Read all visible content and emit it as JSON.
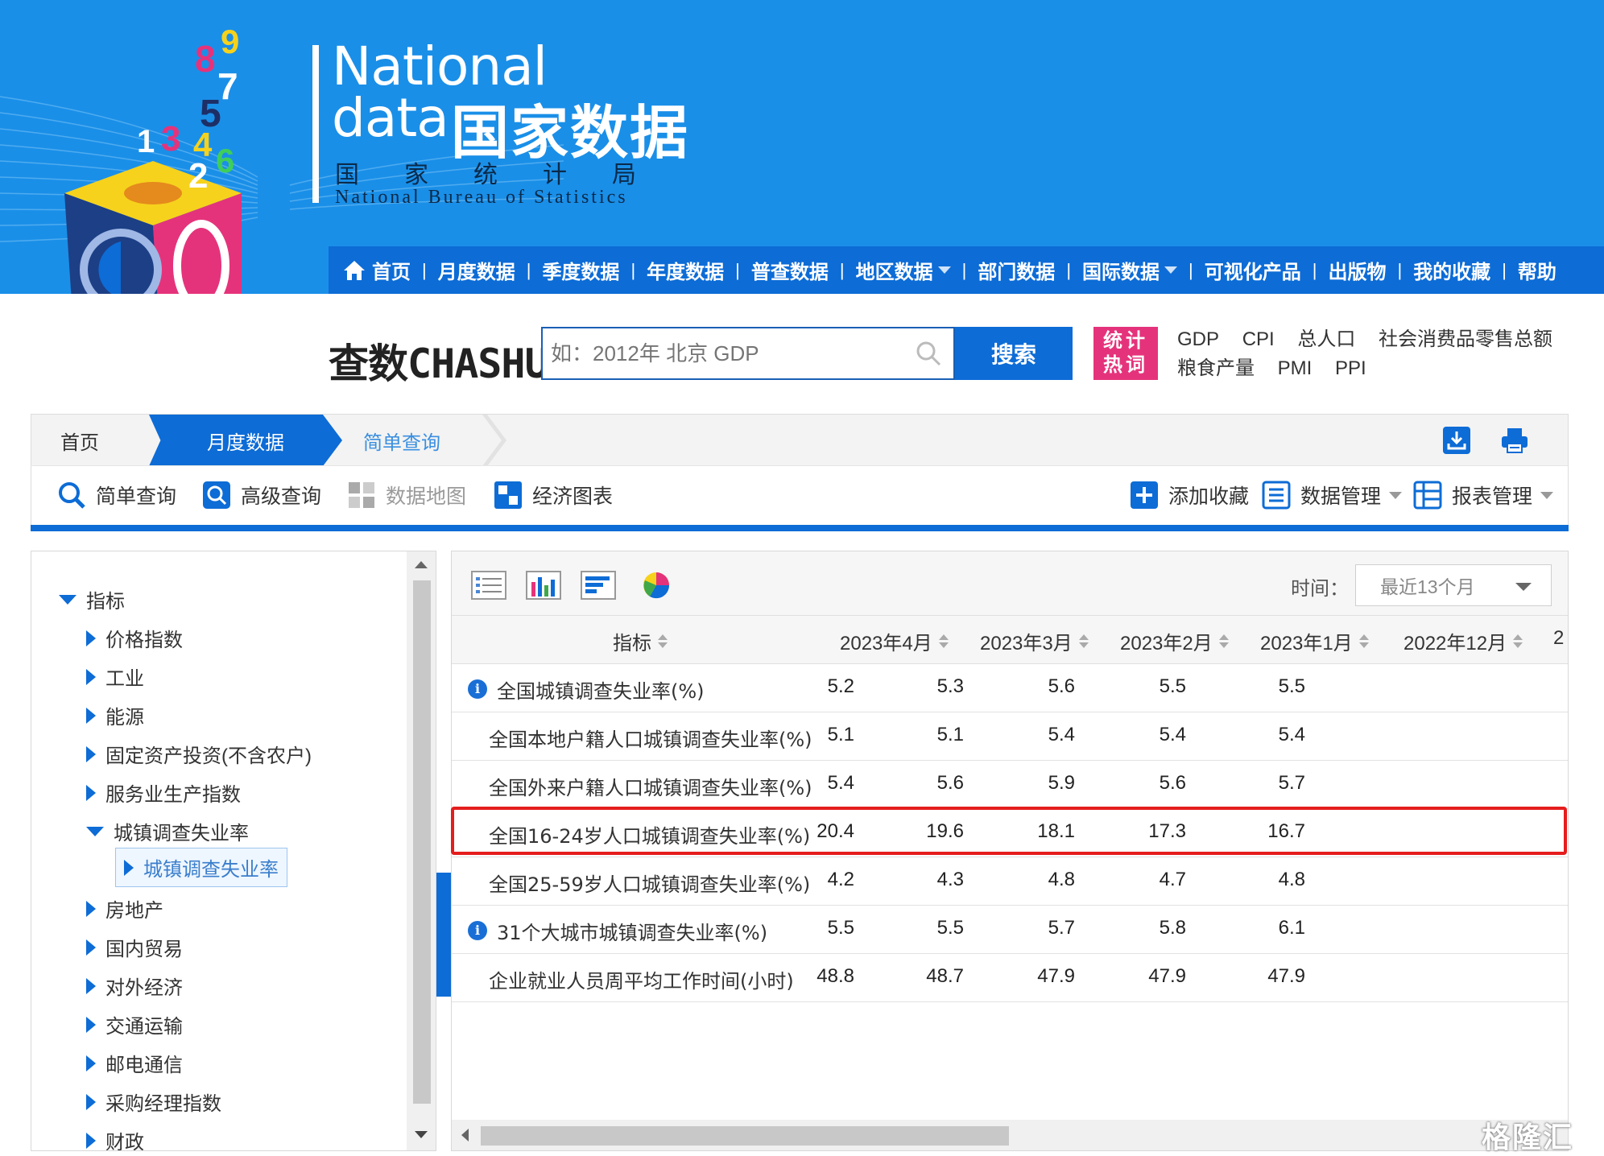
{
  "header": {
    "logo_en_line1": "National",
    "logo_en_line2": "data",
    "logo_cn": "国家数据",
    "bureau_cn": "国家统计局",
    "bureau_en": "National Bureau of Statistics",
    "logo_digits": [
      "8",
      "9",
      "7",
      "5",
      "1",
      "3",
      "4",
      "6",
      "2"
    ]
  },
  "nav": {
    "items": [
      {
        "label": "首页",
        "icon": "home-icon"
      },
      {
        "label": "月度数据"
      },
      {
        "label": "季度数据"
      },
      {
        "label": "年度数据"
      },
      {
        "label": "普查数据"
      },
      {
        "label": "地区数据",
        "dropdown": true
      },
      {
        "label": "部门数据"
      },
      {
        "label": "国际数据",
        "dropdown": true
      },
      {
        "label": "可视化产品"
      },
      {
        "label": "出版物"
      },
      {
        "label": "我的收藏"
      },
      {
        "label": "帮助"
      }
    ],
    "separator": "|"
  },
  "search": {
    "logo_part1": "查数",
    "logo_part2": "CHASHU",
    "placeholder": "如：2012年 北京 GDP",
    "button_label": "搜索",
    "hot_badge_line1": "统计",
    "hot_badge_line2": "热词",
    "hot_words_row1": [
      "GDP",
      "CPI",
      "总人口",
      "社会消费品零售总额"
    ],
    "hot_words_row2": [
      "粮食产量",
      "PMI",
      "PPI"
    ]
  },
  "breadcrumb": {
    "home": "首页",
    "section": "月度数据",
    "current": "简单查询"
  },
  "toolbar": {
    "left": [
      {
        "label": "简单查询",
        "icon": "search-icon",
        "enabled": true
      },
      {
        "label": "高级查询",
        "icon": "advanced-search-icon",
        "enabled": true
      },
      {
        "label": "数据地图",
        "icon": "map-icon",
        "enabled": false
      },
      {
        "label": "经济图表",
        "icon": "chart-grid-icon",
        "enabled": true
      }
    ],
    "right": [
      {
        "label": "添加收藏",
        "icon": "plus-icon"
      },
      {
        "label": "数据管理",
        "icon": "list-icon",
        "dropdown": true
      },
      {
        "label": "报表管理",
        "icon": "table-icon",
        "dropdown": true
      }
    ]
  },
  "tree": {
    "root": "指标",
    "items": [
      {
        "label": "价格指数",
        "expanded": false
      },
      {
        "label": "工业",
        "expanded": false
      },
      {
        "label": "能源",
        "expanded": false
      },
      {
        "label": "固定资产投资(不含农户)",
        "expanded": false
      },
      {
        "label": "服务业生产指数",
        "expanded": false
      },
      {
        "label": "城镇调查失业率",
        "expanded": true
      },
      {
        "label": "城镇调查失业率",
        "child": true,
        "selected": true
      },
      {
        "label": "房地产",
        "expanded": false
      },
      {
        "label": "国内贸易",
        "expanded": false
      },
      {
        "label": "对外经济",
        "expanded": false
      },
      {
        "label": "交通运输",
        "expanded": false
      },
      {
        "label": "邮电通信",
        "expanded": false
      },
      {
        "label": "采购经理指数",
        "expanded": false
      },
      {
        "label": "财政",
        "expanded": false
      }
    ]
  },
  "data_view": {
    "view_icons": [
      "table-view-icon",
      "bar-chart-icon",
      "horizontal-bar-icon",
      "pie-chart-icon"
    ],
    "time_label": "时间：",
    "time_value": "最近13个月",
    "columns": [
      "指标",
      "2023年4月",
      "2023年3月",
      "2023年2月",
      "2023年1月",
      "2022年12月",
      "2"
    ],
    "rows": [
      {
        "name": "全国城镇调查失业率(%)",
        "info": true,
        "values": [
          "5.2",
          "5.3",
          "5.6",
          "5.5",
          "5.5"
        ]
      },
      {
        "name": "全国本地户籍人口城镇调查失业率(%)",
        "info": false,
        "values": [
          "5.1",
          "5.1",
          "5.4",
          "5.4",
          "5.4"
        ]
      },
      {
        "name": "全国外来户籍人口城镇调查失业率(%)",
        "info": false,
        "values": [
          "5.4",
          "5.6",
          "5.9",
          "5.6",
          "5.7"
        ]
      },
      {
        "name": "全国16-24岁人口城镇调查失业率(%)",
        "info": false,
        "highlight": true,
        "values": [
          "20.4",
          "19.6",
          "18.1",
          "17.3",
          "16.7"
        ]
      },
      {
        "name": "全国25-59岁人口城镇调查失业率(%)",
        "info": false,
        "values": [
          "4.2",
          "4.3",
          "4.8",
          "4.7",
          "4.8"
        ]
      },
      {
        "name": "31个大城市城镇调查失业率(%)",
        "info": true,
        "values": [
          "5.5",
          "5.5",
          "5.7",
          "5.8",
          "6.1"
        ]
      },
      {
        "name": "企业就业人员周平均工作时间(小时)",
        "info": false,
        "values": [
          "48.8",
          "48.7",
          "47.9",
          "47.9",
          "47.9"
        ]
      }
    ],
    "highlight_color": "#e51d1d"
  },
  "watermark": "格隆汇",
  "colors": {
    "header_blue": "#1a8fe8",
    "nav_blue": "#0d6cd6",
    "hot_pink": "#e5337b"
  }
}
